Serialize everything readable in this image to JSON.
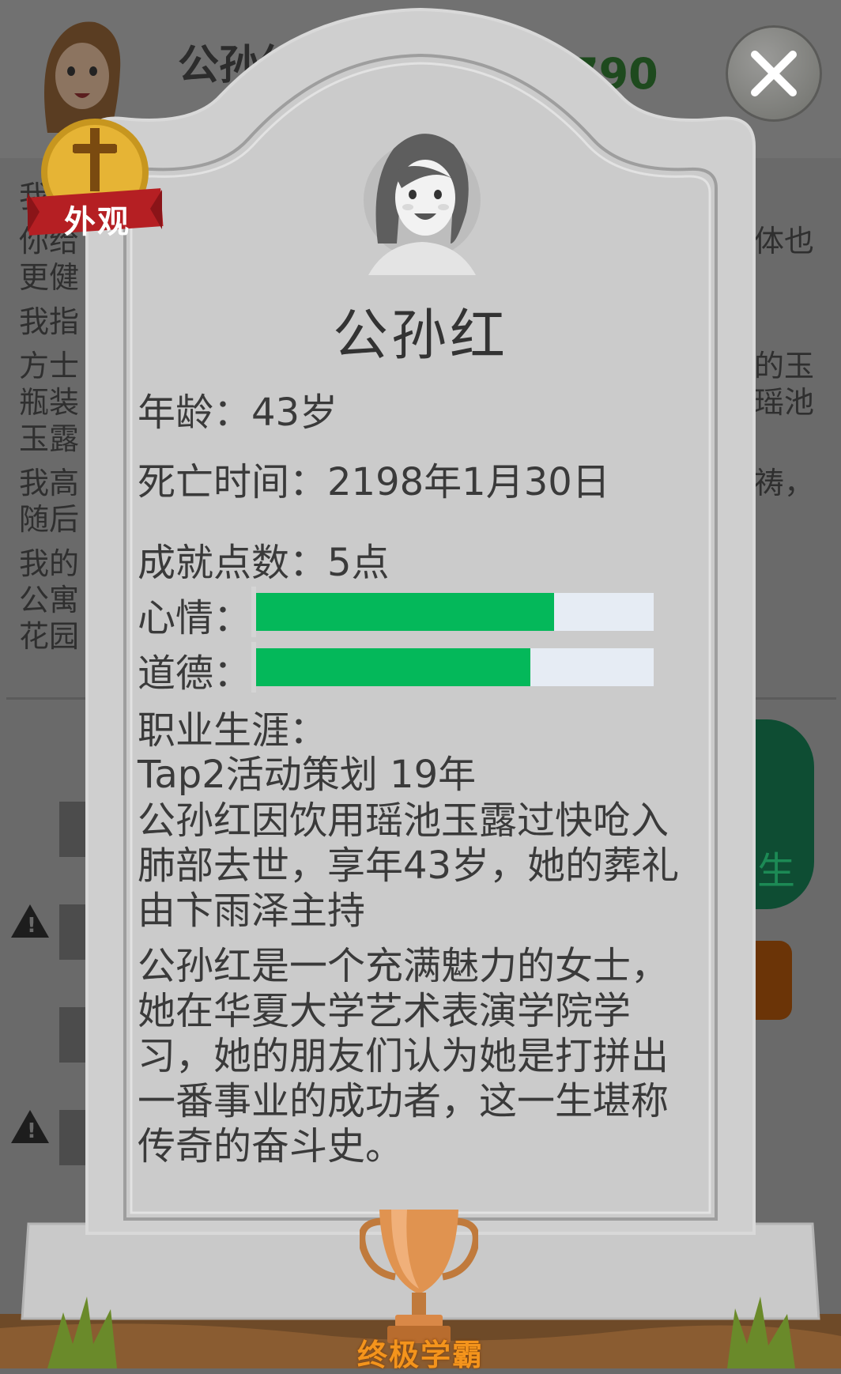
{
  "background": {
    "header_name": "公孙红",
    "header_money": "790",
    "story_lines": [
      "我",
      "你给",
      "更健",
      "我指",
      "方士",
      "瓶装",
      "玉露",
      "我高",
      "随后",
      "我的",
      "公寓",
      "花园"
    ],
    "story_lines_right": [
      "体也",
      "的玉",
      "瑶池",
      "祷，"
    ],
    "action_button_label": "生"
  },
  "tombstone": {
    "name": "公孙红",
    "age": "年龄：43岁",
    "death_time": "死亡时间：2198年1月30日",
    "achievement_points": "成就点数：5点",
    "mood_label": "心情：",
    "mood_level": 0.75,
    "morality_label": "道德：",
    "morality_level": 0.69,
    "career_title": "职业生涯：",
    "career_value": "Tap2活动策划 19年",
    "death_description": "公孙红因饮用瑶池玉露过快呛入肺部去世，享年43岁，她的葬礼由卞雨泽主持",
    "life_description": "公孙红是一个充满魅力的女士，她在华夏大学艺术表演学院学习，她的朋友们认为她是打拼出一番事业的成功者，这一生堪称传奇的奋斗史。"
  },
  "appearance_badge": {
    "label": "外观",
    "icon": "cross-icon"
  },
  "close_button": {
    "icon": "close-icon"
  },
  "trophy": {
    "icon": "bronze-trophy-icon",
    "title": "终极学霸"
  },
  "colors": {
    "bar_fill": "#04b85a",
    "bar_track": "#e6ecf4",
    "tombstone": "#cecece",
    "title_badge": "#f4941c"
  }
}
